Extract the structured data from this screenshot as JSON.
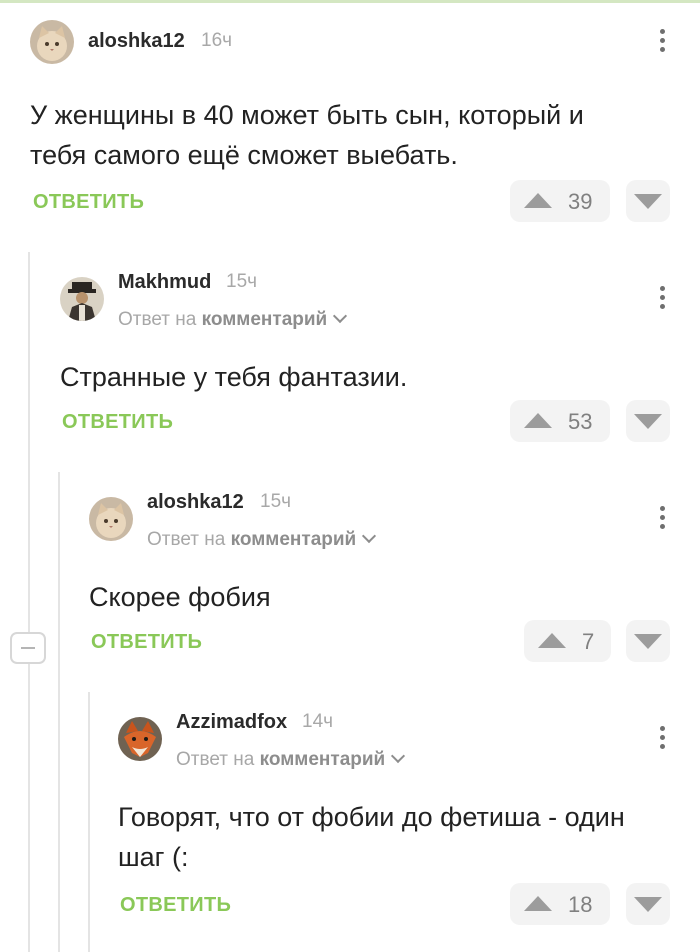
{
  "reply_prefix": "Ответ на",
  "comments": [
    {
      "author": "aloshka12",
      "time": "16ч",
      "avatar": "cat-avatar",
      "reply_to": "",
      "lines": [
        "У женщины в 40 может быть сын, который и",
        "тебя самого ещё сможет выебать."
      ],
      "reply_label": "ОТВЕТИТЬ",
      "score": "39"
    },
    {
      "author": "Makhmud",
      "time": "15ч",
      "avatar": "man-in-hat-avatar",
      "reply_to": "комментарий",
      "lines": [
        "Странные у тебя фантазии."
      ],
      "reply_label": "ОТВЕТИТЬ",
      "score": "53"
    },
    {
      "author": "aloshka12",
      "time": "15ч",
      "avatar": "cat-avatar",
      "reply_to": "комментарий",
      "lines": [
        "Скорее фобия"
      ],
      "reply_label": "ОТВЕТИТЬ",
      "score": "7"
    },
    {
      "author": "Azzimadfox",
      "time": "14ч",
      "avatar": "fox-avatar",
      "reply_to": "комментарий",
      "lines": [
        "Говорят, что от фобии до фетиша - один",
        "шаг (:"
      ],
      "reply_label": "ОТВЕТИТЬ",
      "score": "18"
    }
  ],
  "colors": {
    "accent": "#8ac858",
    "thread_line": "#e4e4e4",
    "vote_bg": "#f3f3f3"
  },
  "icons": [
    "more-vertical-icon",
    "upvote-icon",
    "downvote-icon",
    "collapse-thread-icon",
    "chevron-down-icon"
  ]
}
